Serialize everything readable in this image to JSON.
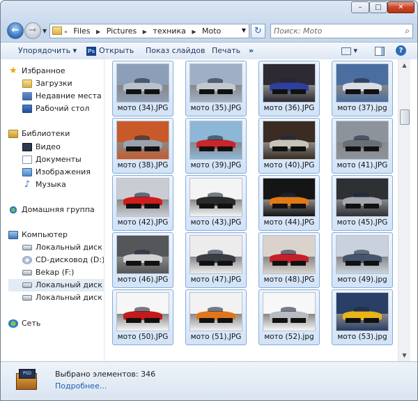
{
  "window": {
    "minimize_glyph": "–",
    "maximize_glyph": "□",
    "close_glyph": "✕"
  },
  "nav": {
    "back_glyph": "←",
    "forward_glyph": "→",
    "history_dropdown_glyph": "▼"
  },
  "address": {
    "lead_glyph": "«",
    "crumbs": [
      "Files",
      "Pictures",
      "техника",
      "Moto"
    ],
    "separator_glyph": "▶",
    "dropdown_glyph": "▼"
  },
  "refresh_glyph": "↻",
  "search": {
    "placeholder": "Поиск: Moto",
    "icon_glyph": "⌕"
  },
  "toolbar": {
    "organize_label": "Упорядочить ▾",
    "open_app_badge": "Ps",
    "open_label": "Открыть",
    "slideshow_label": "Показ слайдов",
    "print_label": "Печать",
    "more_label": "»",
    "view_dropdown": "▾",
    "help_label": "?"
  },
  "sidebar": {
    "favorites": {
      "label": "Избранное",
      "icon": "star-icon",
      "glyph": "★"
    },
    "favorites_items": [
      {
        "label": "Загрузки",
        "icon": "downloads-folder-icon"
      },
      {
        "label": "Недавние места",
        "icon": "recent-places-icon"
      },
      {
        "label": "Рабочий стол",
        "icon": "desktop-icon"
      }
    ],
    "libraries": {
      "label": "Библиотеки",
      "icon": "libraries-icon"
    },
    "library_items": [
      {
        "label": "Видео",
        "icon": "video-library-icon"
      },
      {
        "label": "Документы",
        "icon": "documents-library-icon"
      },
      {
        "label": "Изображения",
        "icon": "pictures-library-icon"
      },
      {
        "label": "Музыка",
        "icon": "music-library-icon",
        "glyph": "♪"
      }
    ],
    "homegroup": {
      "label": "Домашняя группа",
      "icon": "homegroup-icon"
    },
    "computer": {
      "label": "Компьютер",
      "icon": "computer-icon"
    },
    "computer_items": [
      {
        "label": "Локальный диск (C",
        "icon": "local-disk-icon"
      },
      {
        "label": "CD-дисковод (D:)",
        "icon": "cd-drive-icon"
      },
      {
        "label": "Bekap (F:)",
        "icon": "disk-drive-icon"
      },
      {
        "label": "Локальный диск (G",
        "icon": "local-disk-icon"
      },
      {
        "label": "Локальный диск (Y:",
        "icon": "local-disk-icon"
      }
    ],
    "network": {
      "label": "Сеть",
      "icon": "network-icon"
    }
  },
  "files": [
    {
      "name": "мото (34).JPG",
      "bg": "#8d9fb8",
      "car": "#b9c2cc"
    },
    {
      "name": "мото (35).JPG",
      "bg": "#9fb0c6",
      "car": "#c1c8d0"
    },
    {
      "name": "мото (36).JPG",
      "bg": "#2d2a33",
      "car": "#2f3f9e"
    },
    {
      "name": "мото (37).jpg",
      "bg": "#4a6ea0",
      "car": "#d9dde2"
    },
    {
      "name": "мото (38).JPG",
      "bg": "#c85a2a",
      "car": "#9aa3ad"
    },
    {
      "name": "мото (39).JPG",
      "bg": "#8cb7d6",
      "car": "#c8262a"
    },
    {
      "name": "мото (40).JPG",
      "bg": "#3a2c22",
      "car": "#c7c3b8"
    },
    {
      "name": "мото (41).JPG",
      "bg": "#8d939b",
      "car": "#6a6f75"
    },
    {
      "name": "мото (42).JPG",
      "bg": "#c9ccd2",
      "car": "#d21c1c"
    },
    {
      "name": "мото (43).JPG",
      "bg": "#f4f4f4",
      "car": "#2a2a2a"
    },
    {
      "name": "мото (44).JPG",
      "bg": "#151515",
      "car": "#e07a18"
    },
    {
      "name": "мото (45).JPG",
      "bg": "#2e3134",
      "car": "#a3a8ae"
    },
    {
      "name": "мото (46).JPG",
      "bg": "#55565a",
      "car": "#d2d2d2"
    },
    {
      "name": "мото (47).JPG",
      "bg": "#ececec",
      "car": "#3a3d42"
    },
    {
      "name": "мото (48).JPG",
      "bg": "#d9d3cc",
      "car": "#c61f2a"
    },
    {
      "name": "мото (49).jpg",
      "bg": "#c9d2dc",
      "car": "#45556e"
    },
    {
      "name": "мото (50).JPG",
      "bg": "#f6f6f6",
      "car": "#c41a1a"
    },
    {
      "name": "мото (51).JPG",
      "bg": "#f2f2f2",
      "car": "#e0761c"
    },
    {
      "name": "мото (52).jpg",
      "bg": "#f7f7f7",
      "car": "#b7bcc3"
    },
    {
      "name": "мото (53).jpg",
      "bg": "#2a3f66",
      "car": "#e8b416"
    }
  ],
  "scrollbar": {
    "up_glyph": "▲",
    "down_glyph": "▼"
  },
  "details": {
    "badge": "PSD",
    "selected_text": "Выбрано элементов: 346",
    "more_link": "Подробнее..."
  }
}
